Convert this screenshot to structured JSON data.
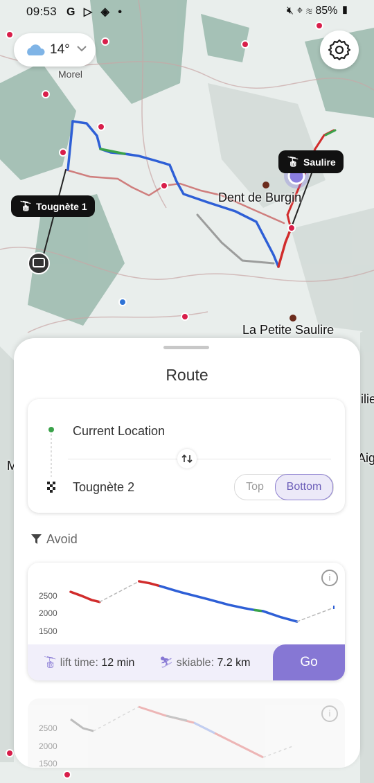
{
  "status_bar": {
    "time": "09:53",
    "apps": "G ▷ ◈ •",
    "battery": "85%"
  },
  "weather": {
    "temperature": "14°"
  },
  "map": {
    "lift_labels": [
      "Tougnète 1",
      "Saulire"
    ],
    "places": [
      "Dent de Burgin",
      "La Petite Saulire",
      "Morel"
    ],
    "edge_text": [
      "ilie",
      "Aig",
      "M"
    ]
  },
  "sheet": {
    "title": "Route",
    "from": "Current Location",
    "to": "Tougnète 2",
    "toggle": {
      "top": "Top",
      "bottom": "Bottom",
      "selected": "Bottom"
    },
    "avoid_label": "Avoid"
  },
  "results": [
    {
      "lift_time_label": "lift time:",
      "lift_time": "12 min",
      "skiable_label": "skiable:",
      "skiable": "7.2 km",
      "go_label": "Go",
      "y_ticks": [
        "2500",
        "2000",
        "1500"
      ]
    },
    {
      "y_ticks": [
        "2500",
        "2000",
        "1500"
      ]
    }
  ],
  "chart_data": {
    "type": "line",
    "title": "",
    "xlabel": "",
    "ylabel": "",
    "ylim": [
      1400,
      2700
    ],
    "series": [
      {
        "x": [
          0,
          4,
          8,
          11
        ],
        "y": [
          2380,
          2300,
          2210,
          2170
        ]
      },
      {
        "x": [
          11,
          26
        ],
        "y": [
          2170,
          2600
        ]
      },
      {
        "x": [
          26,
          30,
          34
        ],
        "y": [
          2600,
          2560,
          2500
        ]
      },
      {
        "x": [
          34,
          42,
          52,
          60,
          66,
          70
        ],
        "y": [
          2500,
          2370,
          2230,
          2110,
          2040,
          2000
        ]
      },
      {
        "x": [
          70,
          73
        ],
        "y": [
          2000,
          1980
        ]
      },
      {
        "x": [
          73,
          80,
          86
        ],
        "y": [
          1980,
          1850,
          1760
        ]
      },
      {
        "x": [
          86,
          100
        ],
        "y": [
          1760,
          2050
        ]
      }
    ],
    "colors": [
      "#d12c2c",
      "#b9b9b9",
      "#d12c2c",
      "#2e5fd6",
      "#3aa24a",
      "#2e5fd6",
      "#b9b9b9"
    ],
    "dashed": [
      false,
      true,
      false,
      false,
      false,
      false,
      true
    ]
  }
}
